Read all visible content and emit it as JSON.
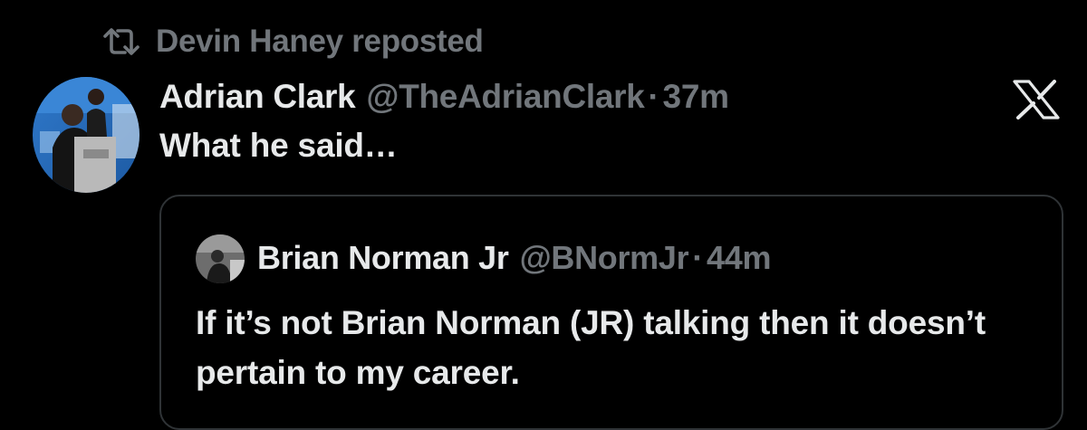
{
  "repost": {
    "icon": "repost-icon",
    "text": "Devin Haney reposted"
  },
  "post": {
    "author_name": "Adrian Clark",
    "author_handle": "@TheAdrianClark",
    "separator": "·",
    "time": "37m",
    "text": "What he said…",
    "avatar_icon": "avatar-photo"
  },
  "platform": {
    "logo_icon": "x-logo-icon"
  },
  "quoted_post": {
    "author_name": "Brian Norman Jr",
    "author_handle": "@BNormJr",
    "separator": "·",
    "time": "44m",
    "text": "If it’s not Brian Norman (JR) talking then it doesn’t pertain to my career.",
    "avatar_icon": "avatar-photo"
  },
  "colors": {
    "background": "#000000",
    "primary_text": "#e7e9ea",
    "secondary_text": "#71767b",
    "border": "#2f3336"
  }
}
